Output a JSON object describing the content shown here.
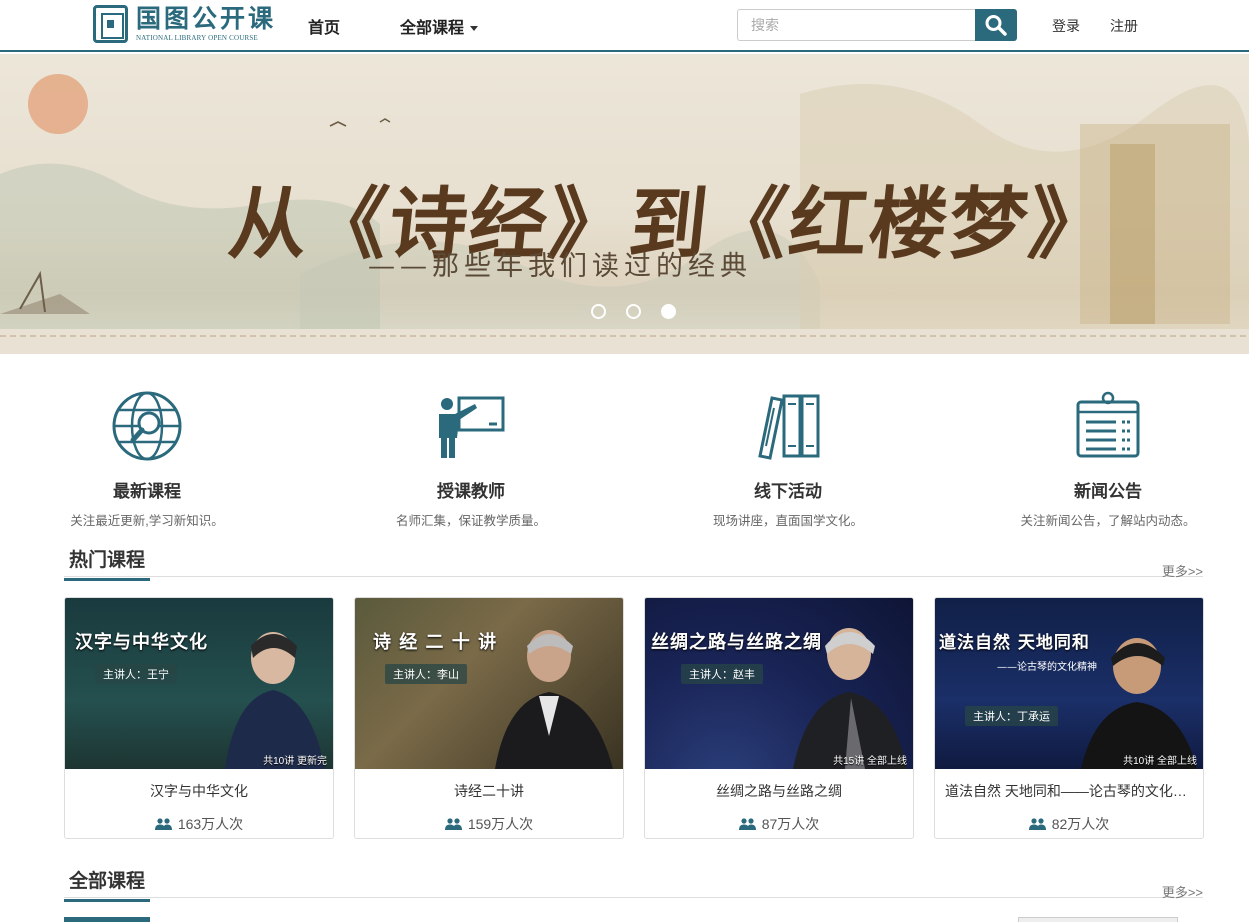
{
  "header": {
    "logo_cn": "国图公开课",
    "logo_en": "NATIONAL LIBRARY OPEN COURSE",
    "nav_home": "首页",
    "nav_all": "全部课程",
    "search_placeholder": "搜索",
    "login": "登录",
    "register": "注册",
    "accent_color": "#2a6a7c"
  },
  "banner": {
    "title": "从《诗经》到《红楼梦》",
    "subtitle": "——那些年我们读过的经典",
    "slides": 3,
    "active_slide": 3
  },
  "features": [
    {
      "icon": "globe-search-icon",
      "title": "最新课程",
      "desc": "关注最近更新,学习新知识。"
    },
    {
      "icon": "teacher-icon",
      "title": "授课教师",
      "desc": "名师汇集，保证教学质量。"
    },
    {
      "icon": "books-icon",
      "title": "线下活动",
      "desc": "现场讲座，直面国学文化。"
    },
    {
      "icon": "bulletin-board-icon",
      "title": "新闻公告",
      "desc": "关注新闻公告，了解站内动态。"
    }
  ],
  "hot": {
    "title": "热门课程",
    "more": "更多>>",
    "courses": [
      {
        "thumb_title": "汉字与中华文化",
        "speaker": "主讲人：王宁",
        "badge": "共10讲  更新完",
        "name": "汉字与中华文化",
        "views": "163万人次"
      },
      {
        "thumb_title": "诗 经 二 十 讲",
        "speaker": "主讲人：李山",
        "badge": "",
        "name": "诗经二十讲",
        "views": "159万人次"
      },
      {
        "thumb_title": "丝绸之路与丝路之绸",
        "speaker": "主讲人：赵丰",
        "badge": "共15讲  全部上线",
        "name": "丝绸之路与丝路之绸",
        "views": "87万人次"
      },
      {
        "thumb_title": "道法自然  天地同和",
        "thumb_sub": "——论古琴的文化精神",
        "speaker": "主讲人：丁承运",
        "badge": "共10讲  全部上线",
        "name": "道法自然 天地同和——论古琴的文化精神",
        "views": "82万人次"
      }
    ]
  },
  "all": {
    "title": "全部课程",
    "more": "更多>>"
  }
}
